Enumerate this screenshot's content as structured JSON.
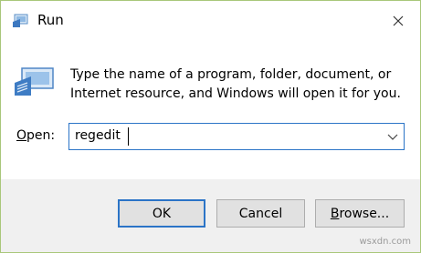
{
  "window": {
    "title": "Run",
    "close_icon": "close-icon"
  },
  "message": {
    "line1": "Type the name of a program, folder, document, or",
    "line2": "Internet resource, and Windows will open it for you."
  },
  "open": {
    "label_prefix": "",
    "label_underlined": "O",
    "label_rest": "pen:",
    "value": "regedit"
  },
  "buttons": {
    "ok": "OK",
    "cancel": "Cancel",
    "browse_underlined": "B",
    "browse_rest": "rowse..."
  },
  "watermark": "wsxdn.com",
  "colors": {
    "accent": "#2b74c7",
    "footer": "#f0f0f0",
    "frame_border": "#a9c77a"
  }
}
